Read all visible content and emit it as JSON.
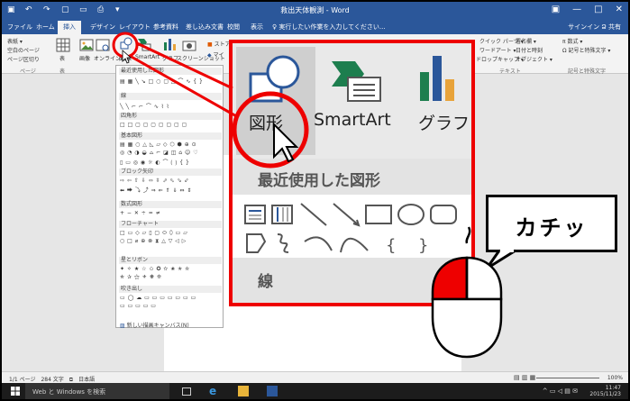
{
  "titlebar": {
    "title": "救出天体観測 - Word",
    "min": "—",
    "max": "□",
    "close": "✕"
  },
  "tabs": {
    "file": "ファイル",
    "home": "ホーム",
    "insert": "挿入",
    "design": "デザイン",
    "layout": "レイアウト",
    "references": "参考資料",
    "mailings": "差し込み文書",
    "review": "校閲",
    "view": "表示",
    "tell_me": "♀ 実行したい作業を入力してください...",
    "sign_in": "サインイン",
    "share": "Ձ 共有"
  },
  "ribbon": {
    "cover": "表紙 ▾",
    "blank": "空白のページ",
    "pagebreak": "ページ区切り",
    "group_pages": "ページ",
    "table": "表",
    "group_table": "表",
    "picture": "画像",
    "online_picture": "オンライン画像",
    "shapes": "図形",
    "smartart": "SmartArt",
    "chart": "グラフ",
    "screenshot": "スクリーンショット",
    "store": "ストア",
    "my_addins": "マイ",
    "quickparts": "クイック パーツ ▾",
    "wordart": "ワードアート ▾",
    "dropcap": "ドロップキャップ ▾",
    "signature": "署名欄 ▾",
    "datetime": "日付と時刻",
    "object": "オブジェクト ▾",
    "group_text": "テキスト",
    "equation": "π 数式 ▾",
    "symbol": "Ω 記号と特殊文字 ▾",
    "group_symbols": "記号と特殊文字"
  },
  "gallery": {
    "recent": "最近使用した図形",
    "recent_shapes": "▤ ▦ ╲ ↘ □ ○ ▢ △ ⌒ ∿ { }",
    "lines": "線",
    "lines_shapes": "╲ ╲ ⌐ ⌐ ⌒ ∿ ⌇ ⌇",
    "rect": "四角形",
    "rect_shapes": "□ □ ▢ ▢ ▢ ▢ ▢ ▢ ▢",
    "basic": "基本図形",
    "basic_row1": "▤ ▦ ○ △ ◺ ▱ ◇ ⬡ ⬢ ⊕ ⊙",
    "basic_row2": "◎ ◔ ◑ ◒ ⌓ ⌐ ◪ ◫ ⌂ ☺ ♡",
    "basic_row3": "▯ ▭ ◎ ◉ ☼ ◐ ⌒ ⟮ ⟯ { }",
    "block": "ブロック矢印",
    "block_row1": "⇨ ⇦ ⇧ ⇩ ⬄ ⇳ ⬀ ⬁ ⬂ ⬃",
    "block_row2": "⬅ ⮕ ⤵ ⤴ ⇒ ⇐ ⇑ ⇓ ⇔ ⇕",
    "equation": "数式図形",
    "equation_row": "+ − ✕ ÷ = ≠",
    "flow": "フローチャート",
    "flow_row1": "□ ▭ ◇ ▱ ▯ ▢ ⬭ ⬯ ▭ ▱",
    "flow_row2": "○ □ ⌀ ⊕ ⊗ ⧗ △ ▽ ◁ ▷",
    "stars": "星とリボン",
    "stars_row1": "✦ ✧ ★ ☆ ✩ ✪ ✫ ✬ ✭ ✮",
    "stars_row2": "✯ ✰ ⚝ ⚜ ❋ ❊",
    "callouts": "吹き出し",
    "callouts_row1": "▭ ◯ ☁ ▭ ▭ ▭ ▭ ▭ ▭ ▭",
    "callouts_row2": "▭ ▭ ▭ ▭ ▭",
    "new_canvas": "新しい描画キャンバス(N)"
  },
  "callout": {
    "shapes_label": "図形",
    "smartart_label": "SmartArt",
    "chart_label": "グラフ",
    "recent_section": "最近使用した図形",
    "lines_section": "線"
  },
  "bubble": {
    "text": "カチッ"
  },
  "statusbar": {
    "page": "1/1 ページ　284 文字　⧉　日本語",
    "zoom": "100%"
  },
  "taskbar": {
    "search": "Web と Windows を検索",
    "time": "11:47",
    "date": "2015/11/23"
  }
}
